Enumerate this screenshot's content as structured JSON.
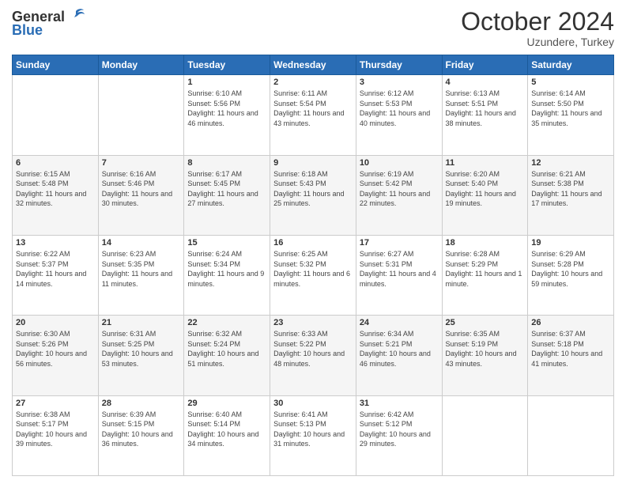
{
  "header": {
    "logo_general": "General",
    "logo_blue": "Blue",
    "main_title": "October 2024",
    "subtitle": "Uzundere, Turkey"
  },
  "days_of_week": [
    "Sunday",
    "Monday",
    "Tuesday",
    "Wednesday",
    "Thursday",
    "Friday",
    "Saturday"
  ],
  "weeks": [
    [
      {
        "day": "",
        "sunrise": "",
        "sunset": "",
        "daylight": ""
      },
      {
        "day": "",
        "sunrise": "",
        "sunset": "",
        "daylight": ""
      },
      {
        "day": "1",
        "sunrise": "Sunrise: 6:10 AM",
        "sunset": "Sunset: 5:56 PM",
        "daylight": "Daylight: 11 hours and 46 minutes."
      },
      {
        "day": "2",
        "sunrise": "Sunrise: 6:11 AM",
        "sunset": "Sunset: 5:54 PM",
        "daylight": "Daylight: 11 hours and 43 minutes."
      },
      {
        "day": "3",
        "sunrise": "Sunrise: 6:12 AM",
        "sunset": "Sunset: 5:53 PM",
        "daylight": "Daylight: 11 hours and 40 minutes."
      },
      {
        "day": "4",
        "sunrise": "Sunrise: 6:13 AM",
        "sunset": "Sunset: 5:51 PM",
        "daylight": "Daylight: 11 hours and 38 minutes."
      },
      {
        "day": "5",
        "sunrise": "Sunrise: 6:14 AM",
        "sunset": "Sunset: 5:50 PM",
        "daylight": "Daylight: 11 hours and 35 minutes."
      }
    ],
    [
      {
        "day": "6",
        "sunrise": "Sunrise: 6:15 AM",
        "sunset": "Sunset: 5:48 PM",
        "daylight": "Daylight: 11 hours and 32 minutes."
      },
      {
        "day": "7",
        "sunrise": "Sunrise: 6:16 AM",
        "sunset": "Sunset: 5:46 PM",
        "daylight": "Daylight: 11 hours and 30 minutes."
      },
      {
        "day": "8",
        "sunrise": "Sunrise: 6:17 AM",
        "sunset": "Sunset: 5:45 PM",
        "daylight": "Daylight: 11 hours and 27 minutes."
      },
      {
        "day": "9",
        "sunrise": "Sunrise: 6:18 AM",
        "sunset": "Sunset: 5:43 PM",
        "daylight": "Daylight: 11 hours and 25 minutes."
      },
      {
        "day": "10",
        "sunrise": "Sunrise: 6:19 AM",
        "sunset": "Sunset: 5:42 PM",
        "daylight": "Daylight: 11 hours and 22 minutes."
      },
      {
        "day": "11",
        "sunrise": "Sunrise: 6:20 AM",
        "sunset": "Sunset: 5:40 PM",
        "daylight": "Daylight: 11 hours and 19 minutes."
      },
      {
        "day": "12",
        "sunrise": "Sunrise: 6:21 AM",
        "sunset": "Sunset: 5:38 PM",
        "daylight": "Daylight: 11 hours and 17 minutes."
      }
    ],
    [
      {
        "day": "13",
        "sunrise": "Sunrise: 6:22 AM",
        "sunset": "Sunset: 5:37 PM",
        "daylight": "Daylight: 11 hours and 14 minutes."
      },
      {
        "day": "14",
        "sunrise": "Sunrise: 6:23 AM",
        "sunset": "Sunset: 5:35 PM",
        "daylight": "Daylight: 11 hours and 11 minutes."
      },
      {
        "day": "15",
        "sunrise": "Sunrise: 6:24 AM",
        "sunset": "Sunset: 5:34 PM",
        "daylight": "Daylight: 11 hours and 9 minutes."
      },
      {
        "day": "16",
        "sunrise": "Sunrise: 6:25 AM",
        "sunset": "Sunset: 5:32 PM",
        "daylight": "Daylight: 11 hours and 6 minutes."
      },
      {
        "day": "17",
        "sunrise": "Sunrise: 6:27 AM",
        "sunset": "Sunset: 5:31 PM",
        "daylight": "Daylight: 11 hours and 4 minutes."
      },
      {
        "day": "18",
        "sunrise": "Sunrise: 6:28 AM",
        "sunset": "Sunset: 5:29 PM",
        "daylight": "Daylight: 11 hours and 1 minute."
      },
      {
        "day": "19",
        "sunrise": "Sunrise: 6:29 AM",
        "sunset": "Sunset: 5:28 PM",
        "daylight": "Daylight: 10 hours and 59 minutes."
      }
    ],
    [
      {
        "day": "20",
        "sunrise": "Sunrise: 6:30 AM",
        "sunset": "Sunset: 5:26 PM",
        "daylight": "Daylight: 10 hours and 56 minutes."
      },
      {
        "day": "21",
        "sunrise": "Sunrise: 6:31 AM",
        "sunset": "Sunset: 5:25 PM",
        "daylight": "Daylight: 10 hours and 53 minutes."
      },
      {
        "day": "22",
        "sunrise": "Sunrise: 6:32 AM",
        "sunset": "Sunset: 5:24 PM",
        "daylight": "Daylight: 10 hours and 51 minutes."
      },
      {
        "day": "23",
        "sunrise": "Sunrise: 6:33 AM",
        "sunset": "Sunset: 5:22 PM",
        "daylight": "Daylight: 10 hours and 48 minutes."
      },
      {
        "day": "24",
        "sunrise": "Sunrise: 6:34 AM",
        "sunset": "Sunset: 5:21 PM",
        "daylight": "Daylight: 10 hours and 46 minutes."
      },
      {
        "day": "25",
        "sunrise": "Sunrise: 6:35 AM",
        "sunset": "Sunset: 5:19 PM",
        "daylight": "Daylight: 10 hours and 43 minutes."
      },
      {
        "day": "26",
        "sunrise": "Sunrise: 6:37 AM",
        "sunset": "Sunset: 5:18 PM",
        "daylight": "Daylight: 10 hours and 41 minutes."
      }
    ],
    [
      {
        "day": "27",
        "sunrise": "Sunrise: 6:38 AM",
        "sunset": "Sunset: 5:17 PM",
        "daylight": "Daylight: 10 hours and 39 minutes."
      },
      {
        "day": "28",
        "sunrise": "Sunrise: 6:39 AM",
        "sunset": "Sunset: 5:15 PM",
        "daylight": "Daylight: 10 hours and 36 minutes."
      },
      {
        "day": "29",
        "sunrise": "Sunrise: 6:40 AM",
        "sunset": "Sunset: 5:14 PM",
        "daylight": "Daylight: 10 hours and 34 minutes."
      },
      {
        "day": "30",
        "sunrise": "Sunrise: 6:41 AM",
        "sunset": "Sunset: 5:13 PM",
        "daylight": "Daylight: 10 hours and 31 minutes."
      },
      {
        "day": "31",
        "sunrise": "Sunrise: 6:42 AM",
        "sunset": "Sunset: 5:12 PM",
        "daylight": "Daylight: 10 hours and 29 minutes."
      },
      {
        "day": "",
        "sunrise": "",
        "sunset": "",
        "daylight": ""
      },
      {
        "day": "",
        "sunrise": "",
        "sunset": "",
        "daylight": ""
      }
    ]
  ]
}
